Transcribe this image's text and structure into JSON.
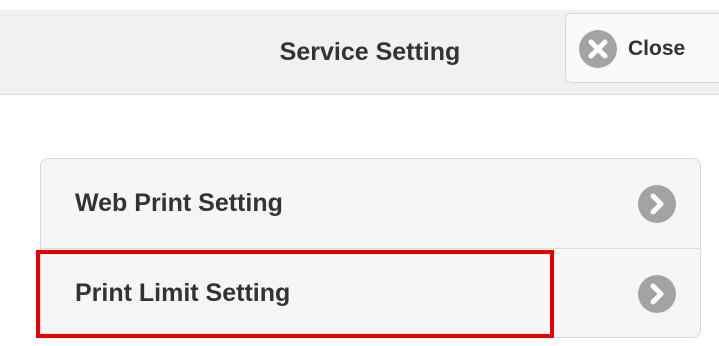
{
  "header": {
    "title": "Service Setting",
    "close_label": "Close",
    "close_icon": "close-circle-icon"
  },
  "menu": {
    "items": [
      {
        "label": "Web Print Setting",
        "icon": "chevron-right-icon"
      },
      {
        "label": "Print Limit Setting",
        "icon": "chevron-right-icon"
      }
    ]
  },
  "colors": {
    "highlight": "#e60000",
    "icon_gray": "#a3a3a3",
    "text": "#333333"
  }
}
